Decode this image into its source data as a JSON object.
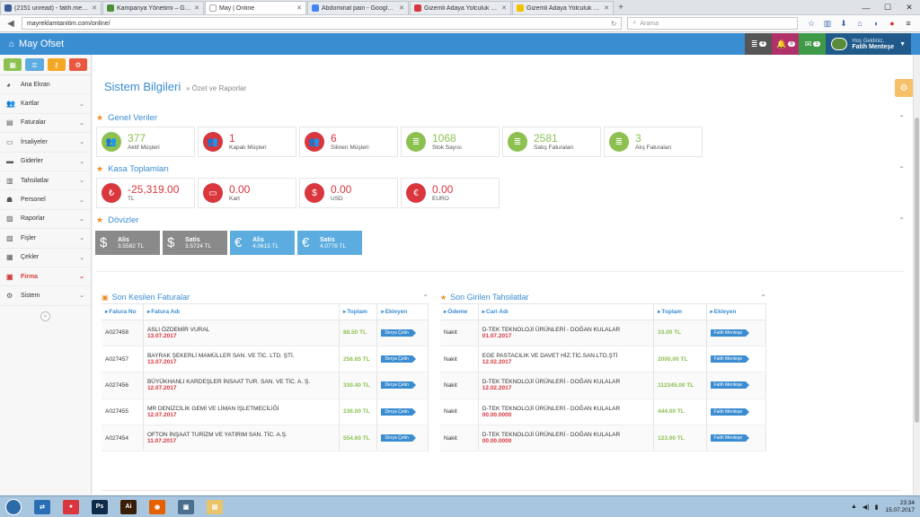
{
  "browser": {
    "tabs": [
      {
        "title": "(2151 unread) - fatih.mentes...",
        "color": "#3b5998",
        "active": false
      },
      {
        "title": "Kampanya Yönetimi – Google...",
        "color": "#4a8f3a",
        "active": false
      },
      {
        "title": "May | Online",
        "color": "#ffffff",
        "active": true
      },
      {
        "title": "Abdominal pain - Google'da Ar...",
        "color": "#4285f4",
        "active": false
      },
      {
        "title": "Gizemli Adaya Yolculuk Türk...",
        "color": "#d9363e",
        "active": false
      },
      {
        "title": "Gizemli Adaya Yolculuk (2013...",
        "color": "#f2c200",
        "active": false
      }
    ],
    "url": "mayreklamtanitim.com/online/",
    "search_placeholder": "Arama"
  },
  "header": {
    "brand": "May Ofset",
    "notifications": [
      {
        "icon": "list-icon",
        "count": "4",
        "color": "#555555"
      },
      {
        "icon": "bell-icon",
        "count": "8",
        "color": "#b0306a"
      },
      {
        "icon": "envelope-icon",
        "count": "5",
        "color": "#3f9a48"
      }
    ],
    "welcome": "Hoş Geldiniz,",
    "username": "Fatih Menteşe"
  },
  "sidebar": {
    "shortcuts": [
      {
        "icon": "chart-icon",
        "color": "#8cc152"
      },
      {
        "icon": "list-icon",
        "color": "#5cacdf"
      },
      {
        "icon": "key-icon",
        "color": "#f5a623"
      },
      {
        "icon": "gears-icon",
        "color": "#e9573f"
      }
    ],
    "items": [
      {
        "label": "Ana Ekran",
        "icon": "palette-icon",
        "chevron": false
      },
      {
        "label": "Kartlar",
        "icon": "users-icon",
        "chevron": true
      },
      {
        "label": "Faturalar",
        "icon": "invoice-icon",
        "chevron": true
      },
      {
        "label": "İrsaliyeler",
        "icon": "file-icon",
        "chevron": true
      },
      {
        "label": "Giderler",
        "icon": "cart-icon",
        "chevron": true
      },
      {
        "label": "Tahsilatlar",
        "icon": "money-icon",
        "chevron": true
      },
      {
        "label": "Personel",
        "icon": "user-icon",
        "chevron": true
      },
      {
        "label": "Raporlar",
        "icon": "report-icon",
        "chevron": true
      },
      {
        "label": "Fişler",
        "icon": "receipt-icon",
        "chevron": true
      },
      {
        "label": "Çekler",
        "icon": "check-icon",
        "chevron": true
      },
      {
        "label": "Firma",
        "icon": "building-icon",
        "chevron": true,
        "active": true
      },
      {
        "label": "Sistem",
        "icon": "gears-icon",
        "chevron": true
      }
    ]
  },
  "page": {
    "title": "Sistem Bilgileri",
    "subtitle": "» Özet ve Raporlar"
  },
  "general": {
    "title": "Genel Veriler",
    "cards": [
      {
        "value": "377",
        "label": "Aktif Müşteri",
        "icon": "users-icon",
        "color": "green"
      },
      {
        "value": "1",
        "label": "Kapalı Müşteri",
        "icon": "users-icon",
        "color": "red"
      },
      {
        "value": "6",
        "label": "Silinen Müşteri",
        "icon": "users-icon",
        "color": "red"
      },
      {
        "value": "1068",
        "label": "Stok Sayısı",
        "icon": "list-icon",
        "color": "green"
      },
      {
        "value": "2581",
        "label": "Satış Faturaları",
        "icon": "list-icon",
        "color": "green"
      },
      {
        "value": "3",
        "label": "Alış Faturaları",
        "icon": "list-icon",
        "color": "green"
      }
    ]
  },
  "kasa": {
    "title": "Kasa Toplamları",
    "cards": [
      {
        "value": "-25,319.00",
        "label": "TL",
        "icon": "lira-icon",
        "glyph": "₺"
      },
      {
        "value": "0.00",
        "label": "Kart",
        "icon": "credit-card-icon",
        "glyph": "▭"
      },
      {
        "value": "0.00",
        "label": "USD",
        "icon": "dollar-icon",
        "glyph": "$"
      },
      {
        "value": "0.00",
        "label": "EURO",
        "icon": "euro-icon",
        "glyph": "€"
      }
    ]
  },
  "doviz": {
    "title": "Dövizler",
    "cards": [
      {
        "label": "Alis",
        "value": "3.5582 TL",
        "glyph": "$",
        "color": "gray",
        "icon": "dollar-icon"
      },
      {
        "label": "Satis",
        "value": "3.5724 TL",
        "glyph": "$",
        "color": "gray",
        "icon": "dollar-icon"
      },
      {
        "label": "Alis",
        "value": "4.0615 TL",
        "glyph": "€",
        "color": "blue",
        "icon": "euro-icon"
      },
      {
        "label": "Satis",
        "value": "4.0778 TL",
        "glyph": "€",
        "color": "blue",
        "icon": "euro-icon"
      }
    ]
  },
  "invoices": {
    "title": "Son Kesilen Faturalar",
    "headers": [
      "Fatura No",
      "Fatura Adı",
      "Toplam",
      "Ekleyen"
    ],
    "rows": [
      {
        "no": "A027458",
        "name": "ASLI ÖZDEMİR VURAL",
        "date": "13.07.2017",
        "total": "88.50 TL",
        "user": "Derya Çetin"
      },
      {
        "no": "A027457",
        "name": "BAYRAK ŞEKERLİ MAMÜLLER SAN. VE TİC. LTD. ŞTİ.",
        "date": "13.07.2017",
        "total": "256.65 TL",
        "user": "Derya Çetin"
      },
      {
        "no": "A027456",
        "name": "BÜYÜKHANLI KARDEŞLER İNSAAT TUR. SAN. VE TİC. A. Ş.",
        "date": "12.07.2017",
        "total": "330.40 TL",
        "user": "Derya Çetin"
      },
      {
        "no": "A027455",
        "name": "MR DENİZCİLİK GEMİ VE LİMAN İŞLETMECİLİĞİ",
        "date": "12.07.2017",
        "total": "236.00 TL",
        "user": "Derya Çetin"
      },
      {
        "no": "A027454",
        "name": "OFTON İNŞAAT TURİZM VE YATIRIM SAN. TİC. A.Ş.",
        "date": "11.07.2017",
        "total": "554.60 TL",
        "user": "Derya Çetin"
      }
    ]
  },
  "collections": {
    "title": "Son Girilen Tahsilatlar",
    "headers": [
      "Ödeme",
      "Cari Adı",
      "Toplam",
      "Ekleyen"
    ],
    "rows": [
      {
        "pay": "Nakit",
        "name": "D-TEK TEKNOLOJİ ÜRÜNLERİ - DOĞAN KULALAR",
        "date": "01.07.2017",
        "total": "33.00 TL",
        "user": "Fatih Menteşe"
      },
      {
        "pay": "Nakit",
        "name": "EGE PASTACILIK VE DAVET HİZ.TİC.SAN.LTD.ŞTİ",
        "date": "12.02.2017",
        "total": "2000.00 TL",
        "user": "Fatih Menteşe"
      },
      {
        "pay": "Nakit",
        "name": "D-TEK TEKNOLOJİ ÜRÜNLERİ - DOĞAN KULALAR",
        "date": "12.02.2017",
        "total": "112345.00 TL",
        "user": "Fatih Menteşe"
      },
      {
        "pay": "Nakit",
        "name": "D-TEK TEKNOLOJİ ÜRÜNLERİ - DOĞAN KULALAR",
        "date": "00.00.0000",
        "total": "444.00 TL",
        "user": "Fatih Menteşe"
      },
      {
        "pay": "Nakit",
        "name": "D-TEK TEKNOLOJİ ÜRÜNLERİ - DOĞAN KULALAR",
        "date": "00.00.0000",
        "total": "123.00 TL",
        "user": "Fatih Menteşe"
      }
    ]
  },
  "taskbar": {
    "apps": [
      {
        "icon": "teamviewer-icon",
        "text": "⇄",
        "color": "#2a6fb5"
      },
      {
        "icon": "chrome-icon",
        "text": "●",
        "color": "#d9363e"
      },
      {
        "icon": "photoshop-icon",
        "text": "Ps",
        "color": "#0d2a4a"
      },
      {
        "icon": "illustrator-icon",
        "text": "Ai",
        "color": "#3a1d05"
      },
      {
        "icon": "firefox-icon",
        "text": "◉",
        "color": "#e66000"
      },
      {
        "icon": "network-icon",
        "text": "▣",
        "color": "#4a6f8f"
      },
      {
        "icon": "explorer-icon",
        "text": "▤",
        "color": "#e9c46a"
      }
    ],
    "time": "23:34",
    "date": "15.07.2017"
  }
}
